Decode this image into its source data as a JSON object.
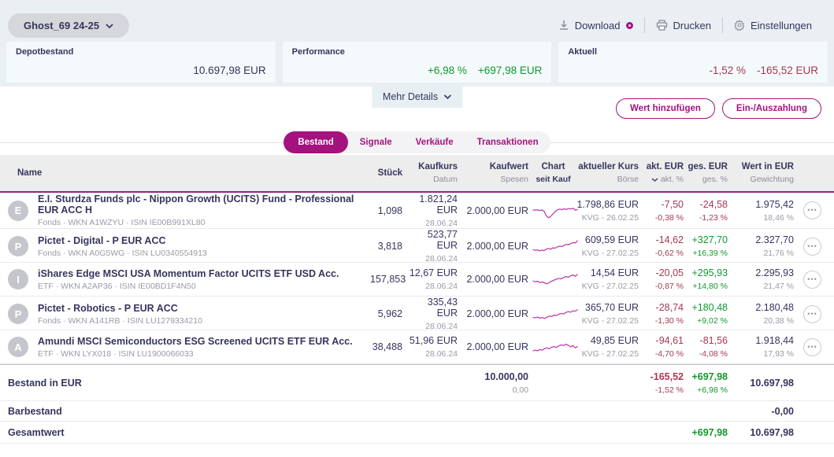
{
  "account": {
    "selector_label": "Ghost_69 24-25"
  },
  "toolbar": {
    "download_label": "Download",
    "print_label": "Drucken",
    "settings_label": "Einstellungen"
  },
  "cards": [
    {
      "title": "Depotbestand",
      "value": "10.697,98 EUR",
      "tone": "neutral"
    },
    {
      "title": "Performance",
      "pct": "+6,98 %",
      "value": "+697,98 EUR",
      "tone": "pos"
    },
    {
      "title": "Aktuell",
      "pct": "-1,52 %",
      "value": "-165,52 EUR",
      "tone": "neg"
    }
  ],
  "mehr_details_label": "Mehr Details",
  "actions": {
    "add_value_label": "Wert hinzufügen",
    "deposit_label": "Ein-/Auszahlung"
  },
  "tabs": [
    {
      "label": "Bestand",
      "active": "true"
    },
    {
      "label": "Signale",
      "active": "false"
    },
    {
      "label": "Verkäufe",
      "active": "false"
    },
    {
      "label": "Transaktionen",
      "active": "false"
    }
  ],
  "table": {
    "columns": [
      {
        "main": "Name",
        "sub": ""
      },
      {
        "main": "Stück",
        "sub": ""
      },
      {
        "main": "Kaufkurs",
        "sub": "Datum"
      },
      {
        "main": "Kaufwert",
        "sub": "Spesen"
      },
      {
        "main": "Chart",
        "sub": "seit Kauf"
      },
      {
        "main": "aktueller Kurs",
        "sub": "Börse"
      },
      {
        "main": "akt. EUR",
        "sub": "akt. %"
      },
      {
        "main": "ges. EUR",
        "sub": "ges. %"
      },
      {
        "main": "Wert in EUR",
        "sub": "Gewichtung"
      }
    ],
    "rows": [
      {
        "initial": "E",
        "name": "E.I. Sturdza Funds plc - Nippon Growth (UCITS) Fund - Professional EUR ACC H",
        "meta": "Fonds · WKN A1WZYU · ISIN IE00B991XL80",
        "stueck": "1,098",
        "kaufkurs": "1.821,24 EUR",
        "datum": "28.06.24",
        "kaufwert": "2.000,00 EUR",
        "akt_kurs": "1.798,86 EUR",
        "boerse": "KVG - 26.02.25",
        "akt_eur": "-7,50",
        "akt_pct": "-0,38 %",
        "akt_tone": "neg",
        "ges_eur": "-24,58",
        "ges_pct": "-1,23 %",
        "ges_tone": "neg",
        "wert": "1.975,42",
        "gewichtung": "18,46 %",
        "spark": [
          55,
          54,
          56,
          52,
          55,
          48,
          20,
          8,
          16,
          32,
          46,
          56,
          60,
          57,
          62,
          59,
          64,
          61,
          65,
          54,
          58
        ]
      },
      {
        "initial": "P",
        "name": "Pictet - Digital - P EUR ACC",
        "meta": "Fonds · WKN A0G5WG · ISIN LU0340554913",
        "stueck": "3,818",
        "kaufkurs": "523,77 EUR",
        "datum": "28.06.24",
        "kaufwert": "2.000,00 EUR",
        "akt_kurs": "609,59 EUR",
        "boerse": "KVG - 27.02.25",
        "akt_eur": "-14,62",
        "akt_pct": "-0,62 %",
        "akt_tone": "neg",
        "ges_eur": "+327,70",
        "ges_pct": "+16,39 %",
        "ges_tone": "pos",
        "wert": "2.327,70",
        "gewichtung": "21,76 %",
        "spark": [
          30,
          25,
          28,
          22,
          26,
          24,
          31,
          36,
          32,
          40,
          38,
          46,
          50,
          48,
          56,
          60,
          58,
          66,
          72,
          70,
          85
        ]
      },
      {
        "initial": "I",
        "name": "iShares Edge MSCI USA Momentum Factor UCITS ETF USD Acc.",
        "meta": "ETF · WKN A2AP36 · ISIN IE00BD1F4N50",
        "stueck": "157,853",
        "kaufkurs": "12,67 EUR",
        "datum": "28.06.24",
        "kaufwert": "2.000,00 EUR",
        "akt_kurs": "14,54 EUR",
        "boerse": "KVG - 27.02.25",
        "akt_eur": "-20,05",
        "akt_pct": "-0,87 %",
        "akt_tone": "neg",
        "ges_eur": "+295,93",
        "ges_pct": "+14,80 %",
        "ges_tone": "pos",
        "wert": "2.295,93",
        "gewichtung": "21,47 %",
        "spark": [
          40,
          35,
          38,
          30,
          34,
          28,
          22,
          30,
          38,
          45,
          50,
          55,
          52,
          60,
          66,
          62,
          70,
          76,
          68,
          80
        ]
      },
      {
        "initial": "P",
        "name": "Pictet - Robotics - P EUR ACC",
        "meta": "Fonds · WKN A141RB · ISIN LU1279334210",
        "stueck": "5,962",
        "kaufkurs": "335,43 EUR",
        "datum": "28.06.24",
        "kaufwert": "2.000,00 EUR",
        "akt_kurs": "365,70 EUR",
        "boerse": "KVG - 27.02.25",
        "akt_eur": "-28,74",
        "akt_pct": "-1,30 %",
        "akt_tone": "neg",
        "ges_eur": "+180,48",
        "ges_pct": "+9,02 %",
        "ges_tone": "pos",
        "wert": "2.180,48",
        "gewichtung": "20,38 %",
        "spark": [
          30,
          26,
          30,
          24,
          28,
          22,
          30,
          36,
          34,
          42,
          40,
          48,
          52,
          50,
          58,
          64,
          60,
          68,
          66,
          76
        ]
      },
      {
        "initial": "A",
        "name": "Amundi MSCI Semiconductors ESG Screened UCITS ETF EUR Acc.",
        "meta": "ETF · WKN LYX018 · ISIN LU1900066033",
        "stueck": "38,488",
        "kaufkurs": "51,96 EUR",
        "datum": "28.06.24",
        "kaufwert": "2.000,00 EUR",
        "akt_kurs": "49,85 EUR",
        "boerse": "KVG - 27.02.25",
        "akt_eur": "-94,61",
        "akt_pct": "-4,70 %",
        "akt_tone": "neg",
        "ges_eur": "-81,56",
        "ges_pct": "-4,08 %",
        "ges_tone": "neg",
        "wert": "1.918,44",
        "gewichtung": "17,93 %",
        "spark": [
          25,
          30,
          26,
          34,
          30,
          40,
          44,
          38,
          48,
          52,
          46,
          56,
          62,
          58,
          66,
          60,
          50,
          58,
          44,
          54
        ]
      }
    ],
    "footer": [
      {
        "label": "Bestand in EUR",
        "kaufwert": "10.000,00",
        "spesen": "0,00",
        "akt_eur": "-165,52",
        "akt_pct": "-1,52 %",
        "akt_tone": "neg",
        "ges_eur": "+697,98",
        "ges_pct": "+6,98 %",
        "ges_tone": "pos",
        "wert": "10.697,98"
      },
      {
        "label": "Barbestand",
        "wert": "-0,00"
      },
      {
        "label": "Gesamtwert",
        "ges_eur": "+697,98",
        "ges_tone": "pos",
        "wert": "10.697,98"
      }
    ]
  },
  "colors": {
    "accent_magenta": "#a5127e",
    "positive_green": "#13982f",
    "negative_red": "#a63950",
    "navy_text": "#35355e",
    "sparkline": "#bb43ae",
    "band_background": "#e9eff3",
    "header_background": "#ededee"
  }
}
